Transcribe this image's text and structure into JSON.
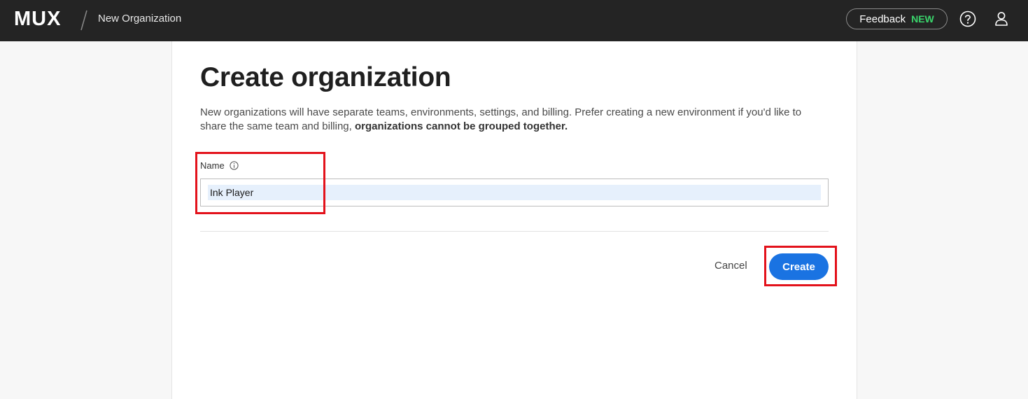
{
  "header": {
    "logo_text": "MUX",
    "breadcrumb": "New Organization",
    "feedback_label": "Feedback",
    "feedback_badge": "NEW",
    "feedback_badge_color": "#3ad46b"
  },
  "main": {
    "title": "Create organization",
    "description_plain": "New organizations will have separate teams, environments, settings, and billing. Prefer creating a new environment if you'd like to share the same team and billing, ",
    "description_bold": "organizations cannot be grouped together.",
    "name_label": "Name",
    "name_value": "Ink Player",
    "cancel_label": "Cancel",
    "create_label": "Create",
    "accent_color": "#1a73e2"
  },
  "annotations": {
    "highlight_color": "#e3121b"
  }
}
